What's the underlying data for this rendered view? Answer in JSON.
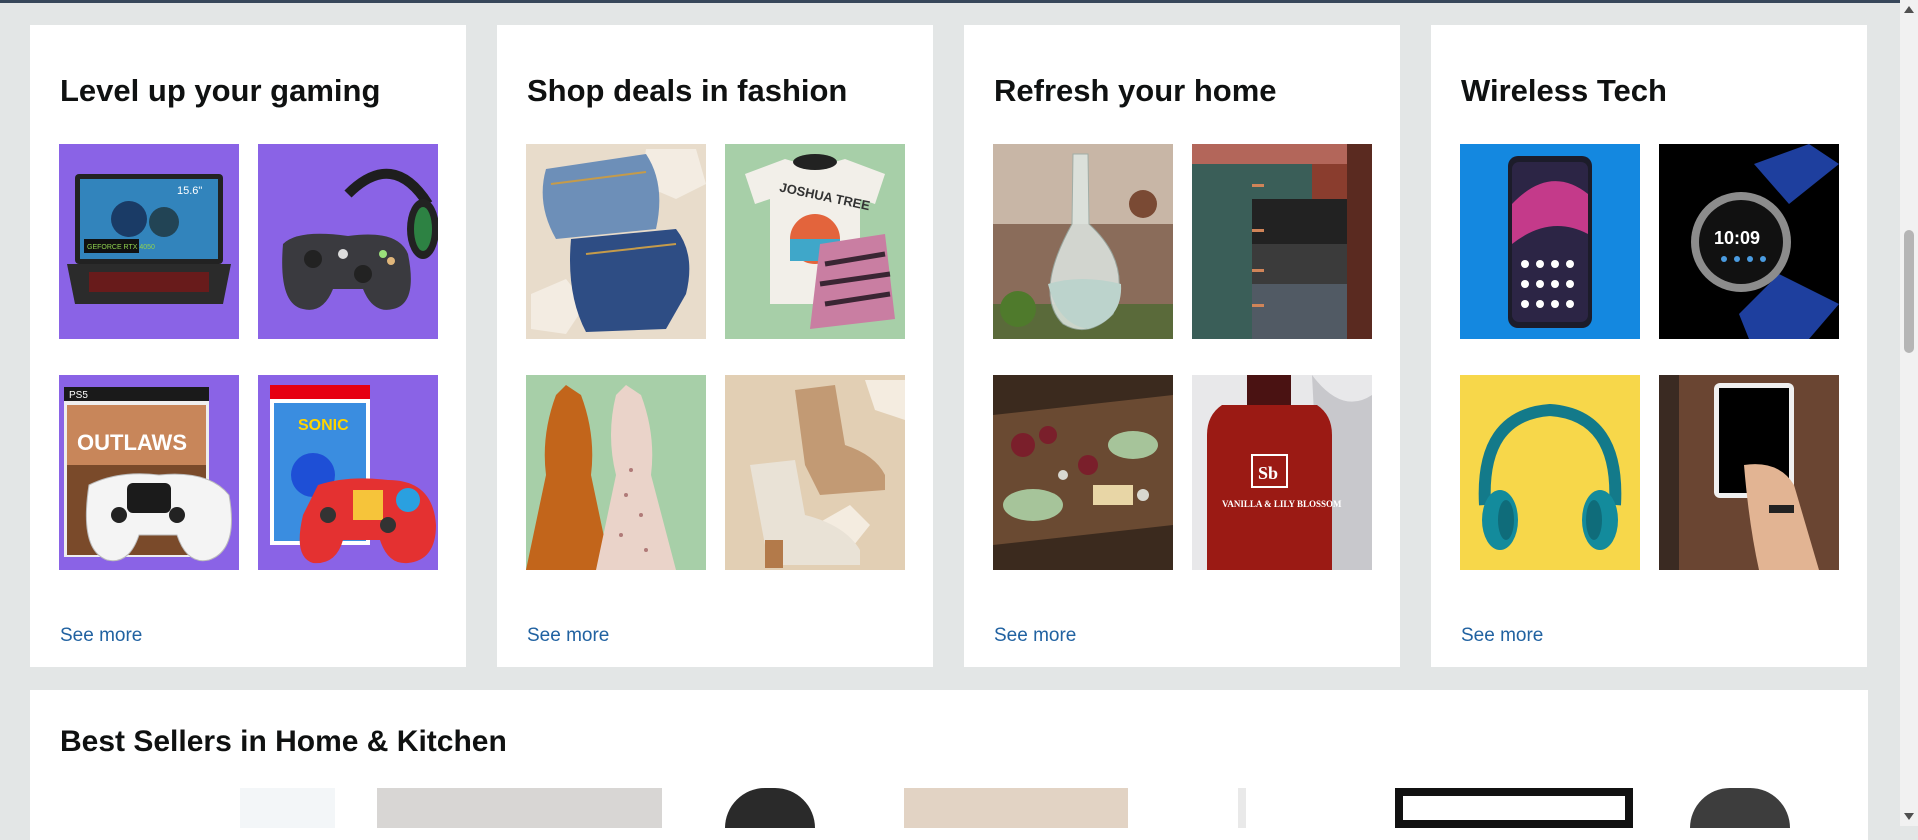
{
  "cards": [
    {
      "title": "Level up your gaming",
      "see_more": "See more",
      "tiles": [
        "gaming-laptop-image",
        "headset-controller-image",
        "ps5-star-wars-bundle-image",
        "sonic-controller-image"
      ]
    },
    {
      "title": "Shop deals in fashion",
      "see_more": "See more",
      "tiles": [
        "jeans-image",
        "tops-image",
        "dresses-image",
        "boots-image"
      ]
    },
    {
      "title": "Refresh your home",
      "see_more": "See more",
      "tiles": [
        "glass-carafe-image",
        "towels-image",
        "serving-board-image",
        "hand-soap-image"
      ]
    },
    {
      "title": "Wireless Tech",
      "see_more": "See more",
      "tiles": [
        "smartphone-image",
        "smartwatch-image",
        "headphones-image",
        "tablet-image"
      ]
    }
  ],
  "phone_text": {
    "watch_time": "10:09",
    "ps5_label": "PS5",
    "game_title": "OUTLAWS",
    "sonic_title": "SONIC",
    "soap_brand": "Sb",
    "soap_label": "VANILLA & LILY BLOSSOM",
    "laptop_badge": "15.6\"",
    "gpu_badge": "GEFORCE RTX 4050",
    "shirt_text": "JOSHUA TREE"
  },
  "best_sellers": {
    "title": "Best Sellers in Home & Kitchen"
  },
  "colors": {
    "link": "#2162a1",
    "purple_bg": "#8a63e6",
    "mint_bg": "#a7cfa8"
  }
}
